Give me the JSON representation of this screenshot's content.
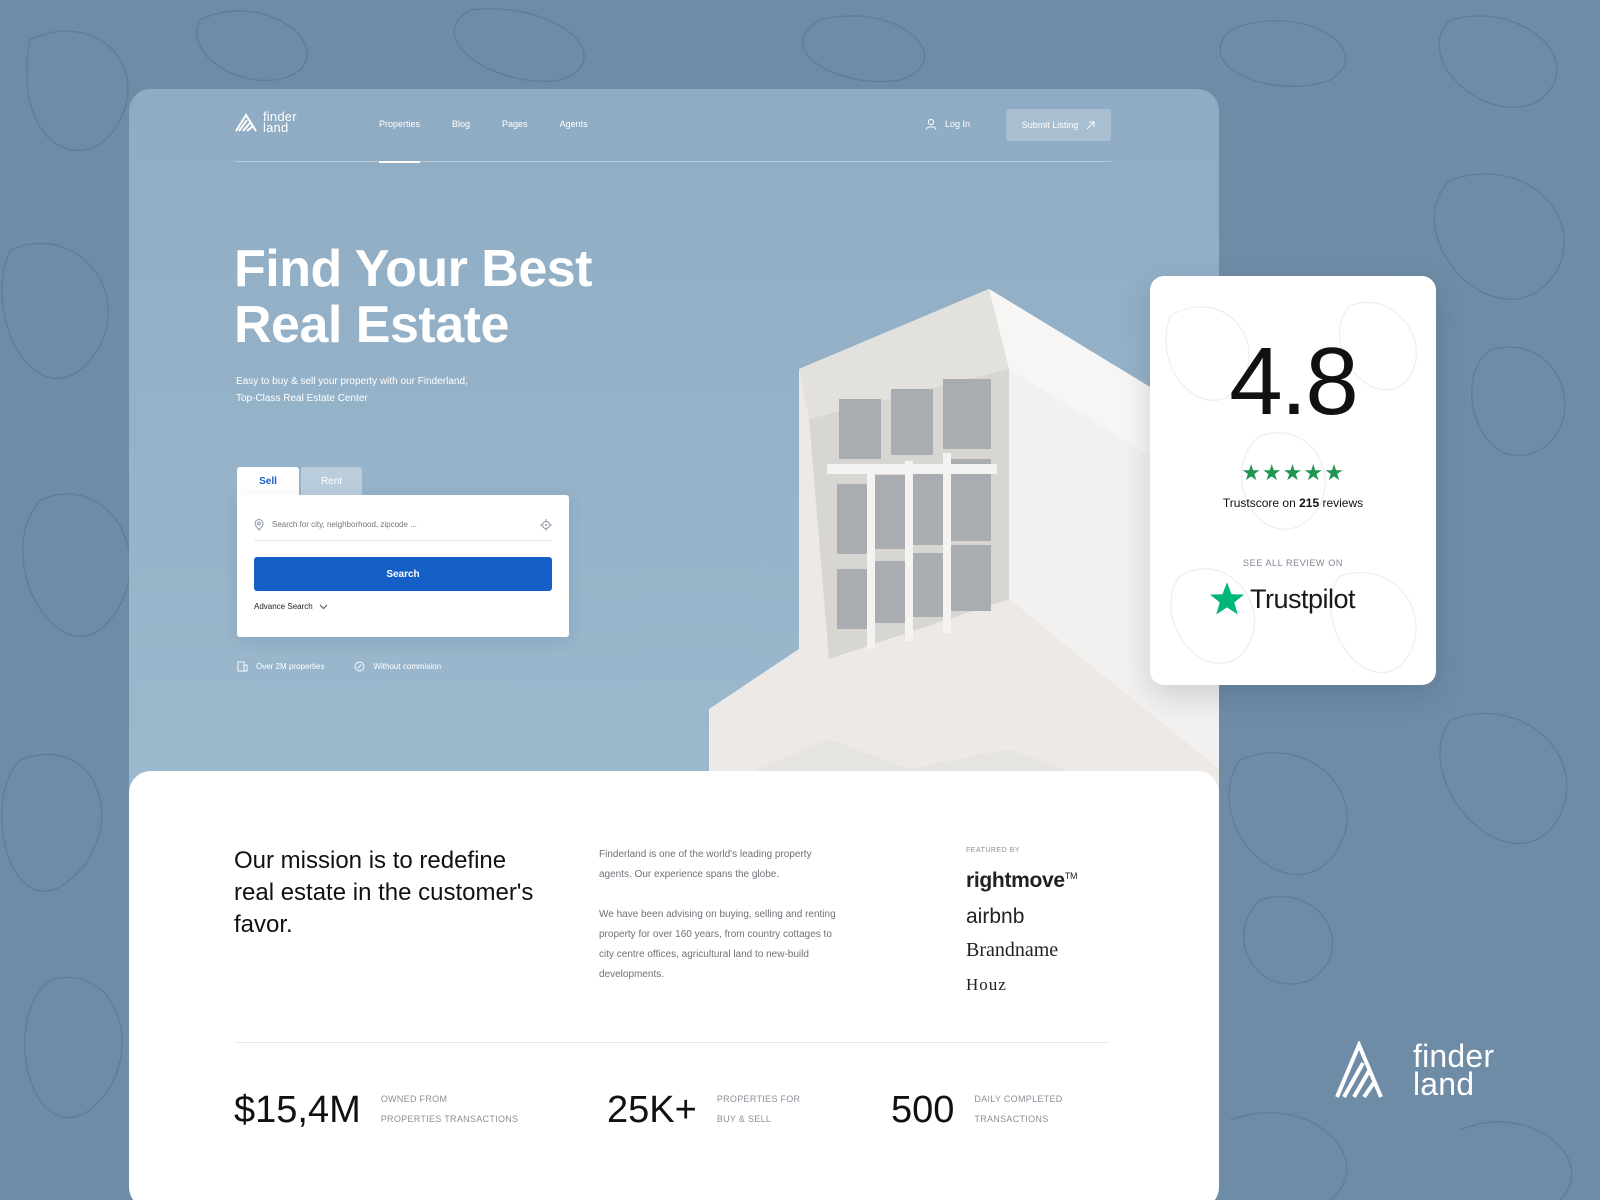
{
  "brand": {
    "logo_line1": "finder",
    "logo_line2": "land"
  },
  "nav": {
    "items": [
      {
        "label": "Properties",
        "active": true
      },
      {
        "label": "Blog"
      },
      {
        "label": "Pages"
      },
      {
        "label": "Agents"
      }
    ],
    "login_label": "Log In",
    "submit_label": "Submit Listing"
  },
  "hero": {
    "title_line1": "Find Your Best",
    "title_line2": "Real Estate",
    "subtitle_line1": "Easy to buy & sell your property with our Finderland,",
    "subtitle_line2": "Top-Class Real Estate Center"
  },
  "search": {
    "tabs": [
      "Sell",
      "Rent"
    ],
    "placeholder": "Search for city, neighborhood, zipcode ...",
    "button_label": "Search",
    "advance_label": "Advance Search"
  },
  "features": [
    "Over 2M properties",
    "Without commision"
  ],
  "about": {
    "mission": "Our mission is to redefine real estate in the customer's favor.",
    "paragraph1": "Finderland is one of the world's leading property agents. Our experience spans the globe.",
    "paragraph2": "We have been advising on buying, selling and renting property for over 160 years, from country cottages to city centre offices, agricultural land to new-build developments.",
    "featured_label": "FEATURED BY",
    "brands": [
      "rightmove",
      "airbnb",
      "Brandname",
      "Houz"
    ],
    "tm": "TM"
  },
  "stats": [
    {
      "value": "$15,4M",
      "label_line1": "OWNED FROM",
      "label_line2": "PROPERTIES TRANSACTIONS"
    },
    {
      "value": "25K+",
      "label_line1": "PROPERTIES FOR",
      "label_line2": "BUY & SELL"
    },
    {
      "value": "500",
      "label_line1": "DAILY COMPLETED",
      "label_line2": "TRANSACTIONS"
    }
  ],
  "trustpilot": {
    "score": "4.8",
    "stars": "★★★★★",
    "reviews_prefix": "Trustscore on",
    "reviews_count": "215",
    "reviews_suffix": "reviews",
    "see_all": "SEE ALL REVIEW ON",
    "brand": "Trustpilot"
  },
  "colors": {
    "background": "#6f8ca6",
    "hero": "#8facc4",
    "accent_blue": "#1560c6",
    "trustpilot_green": "#00b67a"
  }
}
